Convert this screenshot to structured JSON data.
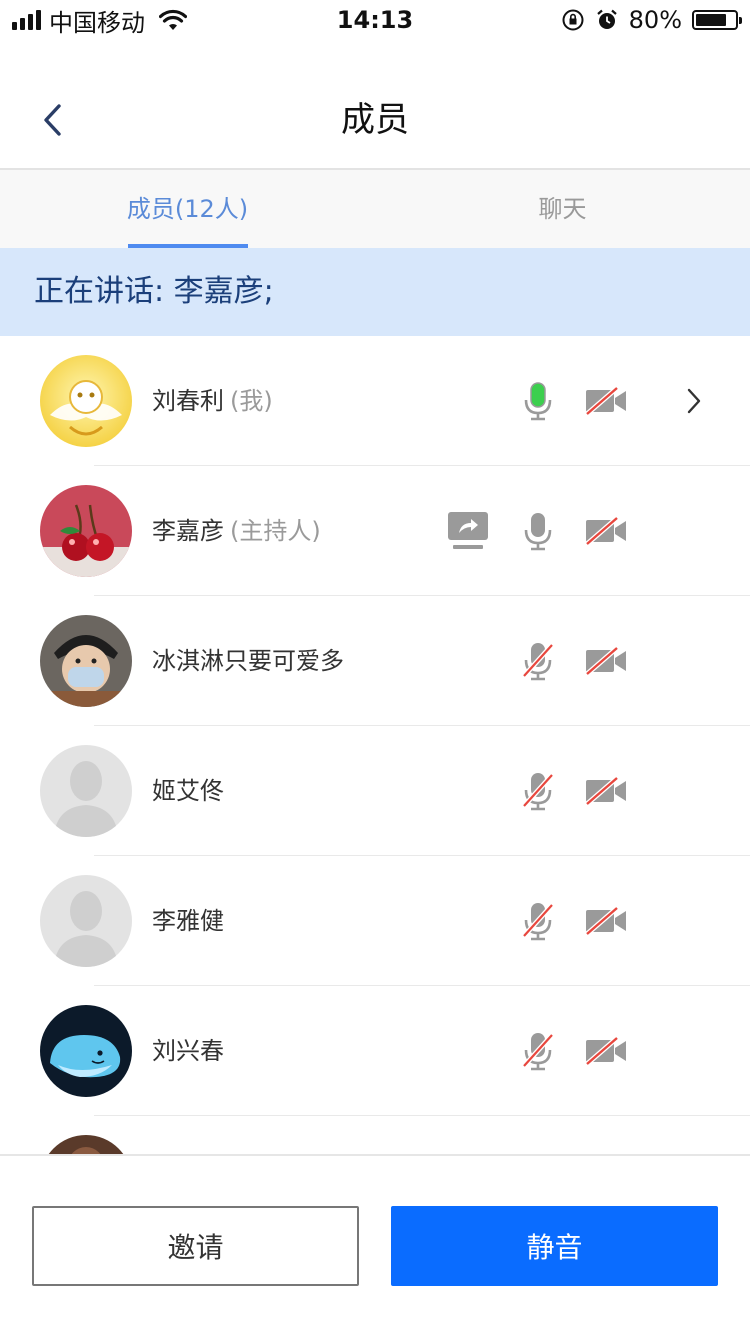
{
  "status_bar": {
    "carrier": "中国移动",
    "time": "14:13",
    "battery": "80%",
    "battery_level": 0.8
  },
  "navbar": {
    "title": "成员",
    "back_icon": "chevron-left-icon"
  },
  "tabs": [
    {
      "label": "成员(12人)",
      "active": true
    },
    {
      "label": "聊天",
      "active": false
    }
  ],
  "speaking": {
    "text": "正在讲话: 李嘉彦;"
  },
  "members": [
    {
      "name": "刘春利",
      "tag": "(我)",
      "mic": "active",
      "camera": "off",
      "share": false,
      "chevron": true,
      "avatar": "cartoon-avatar"
    },
    {
      "name": "李嘉彦",
      "tag": "(主持人)",
      "mic": "on",
      "camera": "off",
      "share": true,
      "chevron": false,
      "avatar": "cherry-avatar"
    },
    {
      "name": "冰淇淋只要可爱多",
      "tag": "",
      "mic": "muted",
      "camera": "off",
      "share": false,
      "chevron": false,
      "avatar": "child-photo-avatar"
    },
    {
      "name": "姬艾佟",
      "tag": "",
      "mic": "muted",
      "camera": "off",
      "share": false,
      "chevron": false,
      "avatar": "default-avatar"
    },
    {
      "name": "李雅健",
      "tag": "",
      "mic": "muted",
      "camera": "off",
      "share": false,
      "chevron": false,
      "avatar": "default-avatar"
    },
    {
      "name": "刘兴春",
      "tag": "",
      "mic": "muted",
      "camera": "off",
      "share": false,
      "chevron": false,
      "avatar": "whale-avatar"
    }
  ],
  "colors": {
    "accent": "#0a6cff",
    "tab_active": "#5b8bd8",
    "banner_bg": "#d7e7fb",
    "mic_active": "#3ccf4e",
    "off_slash": "#e8473e"
  },
  "buttons": {
    "invite": "邀请",
    "mute": "静音"
  }
}
